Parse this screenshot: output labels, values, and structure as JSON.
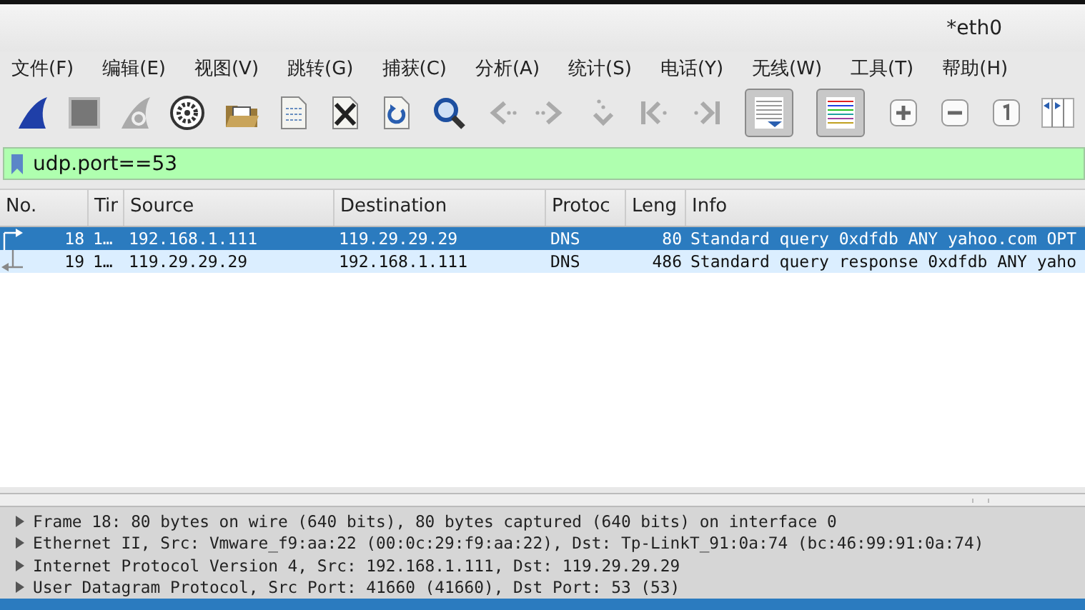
{
  "window": {
    "title": "*eth0"
  },
  "menu": [
    "文件(F)",
    "编辑(E)",
    "视图(V)",
    "跳转(G)",
    "捕获(C)",
    "分析(A)",
    "统计(S)",
    "电话(Y)",
    "无线(W)",
    "工具(T)",
    "帮助(H)"
  ],
  "toolbar": [
    {
      "kind": "fin",
      "pressed": false
    },
    {
      "kind": "stop",
      "pressed": false
    },
    {
      "kind": "restart",
      "pressed": false
    },
    {
      "kind": "gear",
      "pressed": false
    },
    {
      "kind": "gap"
    },
    {
      "kind": "folder",
      "pressed": false
    },
    {
      "kind": "file",
      "pressed": false
    },
    {
      "kind": "closefile",
      "pressed": false
    },
    {
      "kind": "reload",
      "pressed": false
    },
    {
      "kind": "gap"
    },
    {
      "kind": "search",
      "pressed": false
    },
    {
      "kind": "back",
      "pressed": false
    },
    {
      "kind": "forward",
      "pressed": false
    },
    {
      "kind": "goto",
      "pressed": false
    },
    {
      "kind": "first",
      "pressed": false
    },
    {
      "kind": "last",
      "pressed": false
    },
    {
      "kind": "autoscroll",
      "pressed": true
    },
    {
      "kind": "colorize",
      "pressed": true
    },
    {
      "kind": "gap"
    },
    {
      "kind": "zoomin",
      "pressed": false
    },
    {
      "kind": "zoomout",
      "pressed": false
    },
    {
      "kind": "normal",
      "pressed": false
    },
    {
      "kind": "columns",
      "pressed": false
    }
  ],
  "filter": {
    "value": "udp.port==53"
  },
  "packet_list": {
    "columns": [
      "No.",
      "Tir",
      "Source",
      "Destination",
      "Protoc",
      "Leng",
      "Info"
    ],
    "rows": [
      {
        "kind": "request",
        "selected": true,
        "cells": [
          "18",
          "1…",
          "192.168.1.111",
          "119.29.29.29",
          "DNS",
          "80",
          "Standard query 0xdfdb ANY yahoo.com OPT"
        ]
      },
      {
        "kind": "response",
        "selected": false,
        "cells": [
          "19",
          "1…",
          "119.29.29.29",
          "192.168.1.111",
          "DNS",
          "486",
          "Standard query response 0xdfdb ANY yaho"
        ]
      }
    ]
  },
  "details": [
    {
      "text": "Frame 18: 80 bytes on wire (640 bits), 80 bytes captured (640 bits) on interface 0",
      "expanded": false,
      "selected": false
    },
    {
      "text": "Ethernet II, Src: Vmware_f9:aa:22 (00:0c:29:f9:aa:22), Dst: Tp-LinkT_91:0a:74 (bc:46:99:91:0a:74)",
      "expanded": false,
      "selected": false
    },
    {
      "text": "Internet Protocol Version 4, Src: 192.168.1.111, Dst: 119.29.29.29",
      "expanded": false,
      "selected": false
    },
    {
      "text": "User Datagram Protocol, Src Port: 41660 (41660), Dst Port: 53 (53)",
      "expanded": false,
      "selected": false
    },
    {
      "selected": true
    }
  ]
}
